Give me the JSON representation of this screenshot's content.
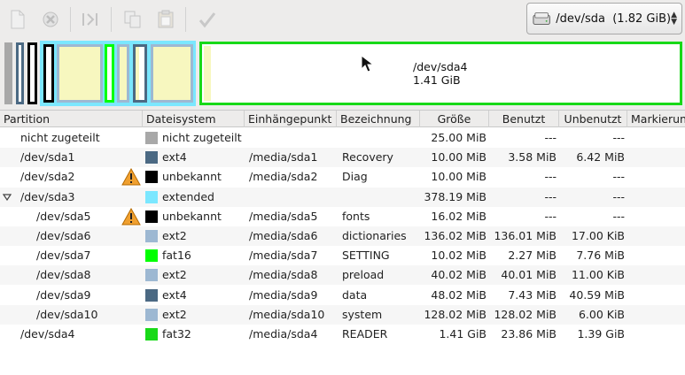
{
  "toolbar": {
    "buttons": [
      {
        "name": "new-icon"
      },
      {
        "name": "delete-icon"
      },
      {
        "name": "resize-move-icon"
      },
      {
        "name": "copy-icon"
      },
      {
        "name": "paste-icon"
      },
      {
        "name": "apply-icon"
      }
    ],
    "device": "/dev/sda  (1.82 GiB)"
  },
  "graph": {
    "selected_name": "/dev/sda4",
    "selected_size": "1.41 GiB",
    "colors": {
      "unallocated": "#a8a8a8",
      "ext4": "#4b6983",
      "unknown": "#000000",
      "extended": "#7be7ff",
      "ext2": "#9db8d2",
      "fat16": "#00ff00",
      "fat32": "#18d918",
      "used": "#f7f7bf",
      "free": "#ffffff"
    }
  },
  "columns": {
    "partition": "Partition",
    "filesystem": "Dateisystem",
    "mountpoint": "Einhängepunkt",
    "label": "Bezeichnung",
    "size": "Größe",
    "used": "Benutzt",
    "unused": "Unbenutzt",
    "flags": "Markierungen"
  },
  "rows": [
    {
      "partition": "nicht zugeteilt",
      "fs": "nicht zugeteilt",
      "color": "#a8a8a8",
      "mount": "",
      "label": "",
      "size": "25.00 MiB",
      "used": "---",
      "unused": "---",
      "warn": false,
      "indent": 0
    },
    {
      "partition": "/dev/sda1",
      "fs": "ext4",
      "color": "#4b6983",
      "mount": "/media/sda1",
      "label": "Recovery",
      "size": "10.00 MiB",
      "used": "3.58 MiB",
      "unused": "6.42 MiB",
      "warn": false,
      "indent": 0
    },
    {
      "partition": "/dev/sda2",
      "fs": "unbekannt",
      "color": "#000000",
      "mount": "/media/sda2",
      "label": "Diag",
      "size": "10.00 MiB",
      "used": "---",
      "unused": "---",
      "warn": true,
      "indent": 0
    },
    {
      "partition": "/dev/sda3",
      "fs": "extended",
      "color": "#7be7ff",
      "mount": "",
      "label": "",
      "size": "378.19 MiB",
      "used": "---",
      "unused": "---",
      "warn": false,
      "indent": 0,
      "expander": true
    },
    {
      "partition": "/dev/sda5",
      "fs": "unbekannt",
      "color": "#000000",
      "mount": "/media/sda5",
      "label": "fonts",
      "size": "16.02 MiB",
      "used": "---",
      "unused": "---",
      "warn": true,
      "indent": 1
    },
    {
      "partition": "/dev/sda6",
      "fs": "ext2",
      "color": "#9db8d2",
      "mount": "/media/sda6",
      "label": "dictionaries",
      "size": "136.02 MiB",
      "used": "136.01 MiB",
      "unused": "17.00 KiB",
      "warn": false,
      "indent": 1
    },
    {
      "partition": "/dev/sda7",
      "fs": "fat16",
      "color": "#00ff00",
      "mount": "/media/sda7",
      "label": "SETTING",
      "size": "10.02 MiB",
      "used": "2.27 MiB",
      "unused": "7.76 MiB",
      "warn": false,
      "indent": 1
    },
    {
      "partition": "/dev/sda8",
      "fs": "ext2",
      "color": "#9db8d2",
      "mount": "/media/sda8",
      "label": "preload",
      "size": "40.02 MiB",
      "used": "40.01 MiB",
      "unused": "11.00 KiB",
      "warn": false,
      "indent": 1
    },
    {
      "partition": "/dev/sda9",
      "fs": "ext4",
      "color": "#4b6983",
      "mount": "/media/sda9",
      "label": "data",
      "size": "48.02 MiB",
      "used": "7.43 MiB",
      "unused": "40.59 MiB",
      "warn": false,
      "indent": 1
    },
    {
      "partition": "/dev/sda10",
      "fs": "ext2",
      "color": "#9db8d2",
      "mount": "/media/sda10",
      "label": "system",
      "size": "128.02 MiB",
      "used": "128.02 MiB",
      "unused": "6.00 KiB",
      "warn": false,
      "indent": 1
    },
    {
      "partition": "/dev/sda4",
      "fs": "fat32",
      "color": "#18d918",
      "mount": "/media/sda4",
      "label": "READER",
      "size": "1.41 GiB",
      "used": "23.86 MiB",
      "unused": "1.39 GiB",
      "warn": false,
      "indent": 0
    }
  ]
}
